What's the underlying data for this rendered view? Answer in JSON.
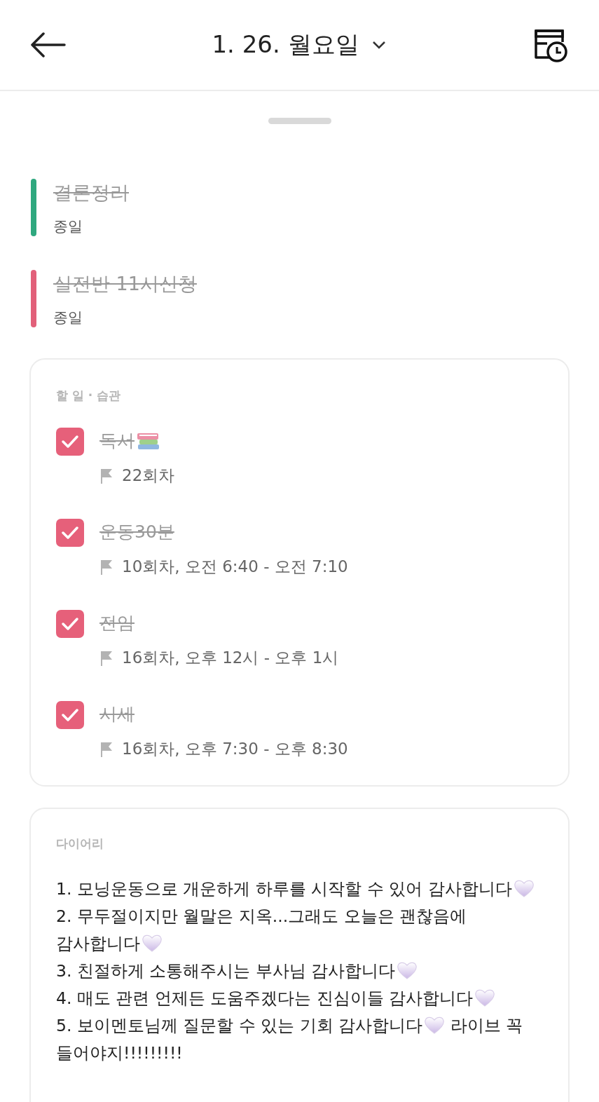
{
  "header": {
    "title": "1. 26. 월요일"
  },
  "events": [
    {
      "title": "결론정리",
      "done": true,
      "subtitle": "종일",
      "color": "#2fa87f"
    },
    {
      "title": "실전반 11시신청",
      "done": true,
      "subtitle": "종일",
      "color": "#e2607a"
    }
  ],
  "todos": {
    "label": "할 일 · 습관",
    "items": [
      {
        "title": [
          {
            "kind": "text",
            "text": "독서"
          },
          {
            "kind": "books"
          }
        ],
        "checked": true,
        "meta": "22회차"
      },
      {
        "title": [
          {
            "kind": "text",
            "text": "운동30분"
          }
        ],
        "checked": true,
        "meta": "10회차, 오전 6:40 - 오전 7:10"
      },
      {
        "title": [
          {
            "kind": "text",
            "text": "전임"
          }
        ],
        "checked": true,
        "meta": "16회차, 오후 12시 - 오후 1시"
      },
      {
        "title": [
          {
            "kind": "text",
            "text": "시세"
          }
        ],
        "checked": true,
        "meta": "16회차, 오후 7:30 - 오후 8:30"
      }
    ]
  },
  "diary": {
    "label": "다이어리",
    "paragraphs": [
      [
        {
          "kind": "text",
          "text": "1. 모닝운동으로 개운하게 하루를 시작할 수 있어 감사합니다"
        },
        {
          "kind": "heart"
        }
      ],
      [
        {
          "kind": "text",
          "text": "2. 무두절이지만 월말은 지옥...그래도 오늘은 괜찮음에 감사합니다"
        },
        {
          "kind": "heart"
        }
      ],
      [
        {
          "kind": "text",
          "text": "3. 친절하게 소통해주시는 부사님 감사합니다"
        },
        {
          "kind": "heart"
        }
      ],
      [
        {
          "kind": "text",
          "text": "4. 매도 관련 언제든 도움주겠다는 진심이들 감사합니다"
        },
        {
          "kind": "heart"
        }
      ],
      [
        {
          "kind": "text",
          "text": "5. 보이멘토님께 질문할 수 있는 기회 감사합니다"
        },
        {
          "kind": "heart"
        },
        {
          "kind": "text",
          "text": " 라이브 꼭 들어야지!!!!!!!!!"
        }
      ]
    ]
  }
}
